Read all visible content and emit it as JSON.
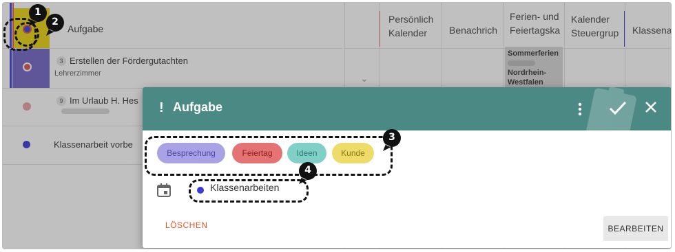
{
  "task_list": {
    "header_label": "Aufgabe",
    "rows": [
      {
        "count": "3",
        "title": "Erstellen der Fördergutachten",
        "subtitle": "Lehrerzimmer"
      },
      {
        "count": "9",
        "title": "Im Urlaub H. Hes"
      },
      {
        "title": "Klassenarbeit vorbe"
      }
    ]
  },
  "columns": [
    {
      "label": "Persönlich\nKalender",
      "accent": "#d9534f"
    },
    {
      "label": "Benachrich"
    },
    {
      "label": "Ferien- und\nFeiertagska"
    },
    {
      "label": "Kalender\nSteuergrup",
      "accent": "#3a3ad6"
    },
    {
      "label": "Klassena"
    }
  ],
  "holiday_event": {
    "line1": "Sommerferien",
    "line2": "Nordrhein-",
    "line3": "Westfalen"
  },
  "dialog": {
    "title_prefix": "!",
    "title": "Aufgabe",
    "categories": [
      {
        "label": "Besprechung",
        "bg": "#a9a3e6",
        "fg": "#4a44a6"
      },
      {
        "label": "Feiertag",
        "bg": "#e57373",
        "fg": "#8e1e1e"
      },
      {
        "label": "Ideen",
        "bg": "#80d0c7",
        "fg": "#2b7c73"
      },
      {
        "label": "Kunde",
        "bg": "#eedc6a",
        "fg": "#8a7a10"
      }
    ],
    "calendar": {
      "name": "Klassenarbeiten",
      "color": "#3a3ad6",
      "icon": "calendar-icon"
    },
    "delete_label": "LÖSCHEN",
    "edit_label": "BEARBEITEN"
  },
  "callouts": [
    {
      "number": "1"
    },
    {
      "number": "2"
    },
    {
      "number": "3"
    },
    {
      "number": "4"
    }
  ],
  "colors": {
    "header": "#4b8a84",
    "delete": "#e8572a"
  }
}
